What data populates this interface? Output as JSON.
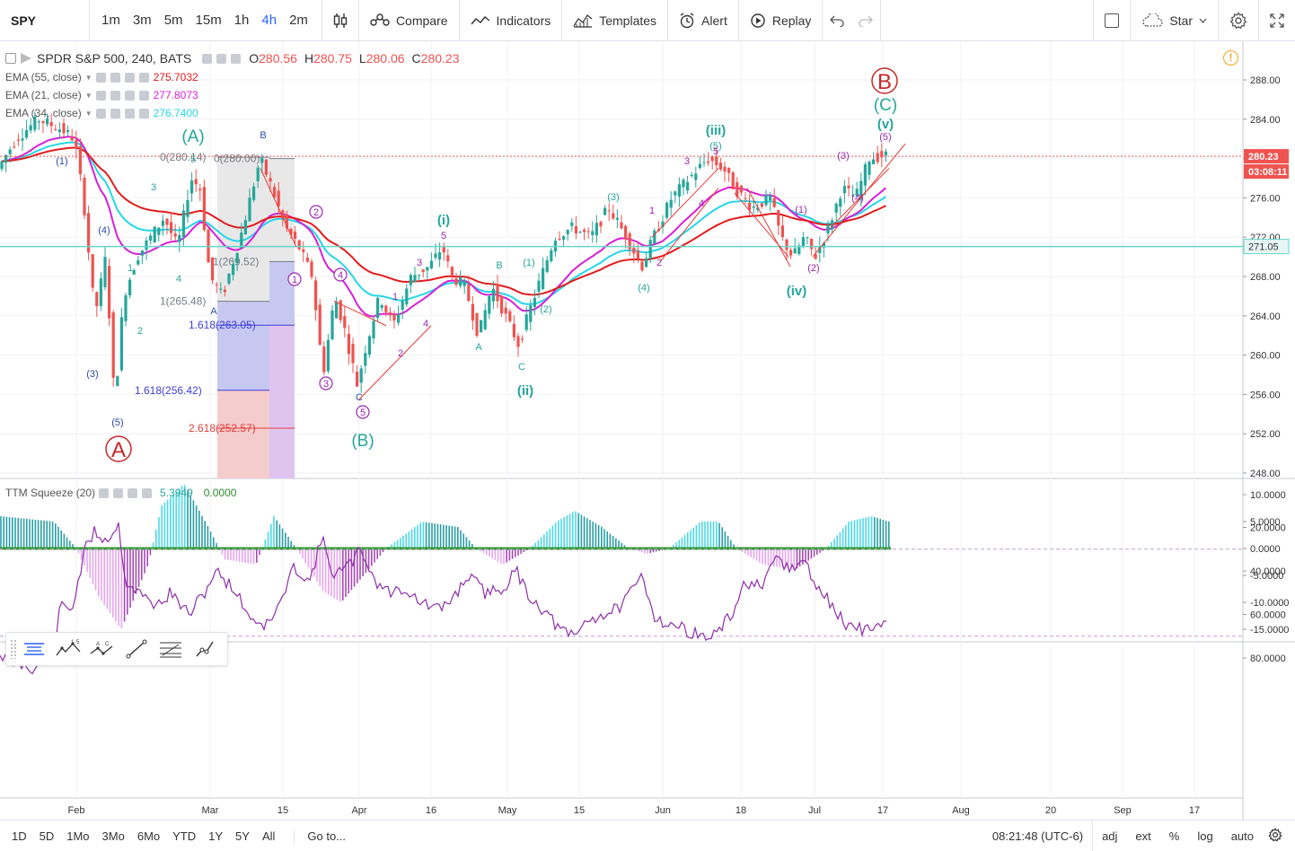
{
  "toolbar": {
    "symbol": "SPY",
    "intervals": [
      "1m",
      "3m",
      "5m",
      "15m",
      "1h",
      "4h",
      "2m"
    ],
    "active_interval": "4h",
    "compare": "Compare",
    "indicators": "Indicators",
    "templates": "Templates",
    "alert": "Alert",
    "replay": "Replay",
    "layout_name": "Star"
  },
  "legend": {
    "title": "SPDR S&P 500, 240, BATS",
    "ohlc": [
      {
        "k": "O",
        "v": "280.56"
      },
      {
        "k": "H",
        "v": "280.75"
      },
      {
        "k": "L",
        "v": "280.06"
      },
      {
        "k": "C",
        "v": "280.23"
      }
    ],
    "studies": [
      {
        "name": "EMA (55, close)",
        "value": "275.7032",
        "color": "#e31c1c"
      },
      {
        "name": "EMA (21, close)",
        "value": "277.8073",
        "color": "#d61fd6"
      },
      {
        "name": "EMA (34, close)",
        "value": "276.7400",
        "color": "#24d6e8"
      }
    ],
    "ttm": {
      "name": "TTM Squeeze (20)",
      "v1": "5.3949",
      "v2": "0.0000"
    }
  },
  "price_axis": {
    "ticks": [
      "288.00",
      "284.00",
      "280.00",
      "276.00",
      "272.00",
      "268.00",
      "264.00",
      "260.00",
      "256.00",
      "252.00",
      "248.00"
    ],
    "last_price": "280.23",
    "countdown": "03:08:11",
    "hline_price": "271.05"
  },
  "ttm_axis": {
    "ticks": [
      "10.0000",
      "5.0000",
      "0.0000",
      "-5.0000",
      "-10.0000",
      "-15.0000"
    ]
  },
  "rsi_axis": {
    "ticks": [
      "80.0000",
      "60.0000",
      "40.0000",
      "20.0000"
    ]
  },
  "time_axis": {
    "labels": [
      "Feb",
      "Mar",
      "15",
      "Apr",
      "16",
      "May",
      "15",
      "Jun",
      "18",
      "Jul",
      "17",
      "Aug",
      "20",
      "Sep",
      "17"
    ]
  },
  "fib": {
    "levels": [
      {
        "label": "0(280.14)",
        "color": "#787b86"
      },
      {
        "label": "0(280.00)",
        "color": "#787b86"
      },
      {
        "label": "1(269.52)",
        "color": "#787b86"
      },
      {
        "label": "1(265.48)",
        "color": "#787b86"
      },
      {
        "label": "1.618(263.05)",
        "color": "#3f3fd6"
      },
      {
        "label": "1.618(256.42)",
        "color": "#3f3fd6"
      },
      {
        "label": "2.618(252.57)",
        "color": "#e03c3c"
      }
    ]
  },
  "wave_labels": {
    "major": [
      "A",
      "B"
    ],
    "intermediate": [
      "(A)",
      "(B)",
      "(C)"
    ],
    "minor": [
      "(i)",
      "(ii)",
      "(iii)",
      "(iv)",
      "(v)"
    ],
    "circled": [
      "1",
      "2",
      "3",
      "4",
      "5"
    ],
    "small": [
      "(1)",
      "(2)",
      "(3)",
      "(4)",
      "(5)",
      "1",
      "2",
      "3",
      "4",
      "5",
      "A",
      "B",
      "C"
    ]
  },
  "bottom": {
    "ranges": [
      "1D",
      "5D",
      "1Mo",
      "3Mo",
      "6Mo",
      "YTD",
      "1Y",
      "5Y",
      "All"
    ],
    "goto": "Go to...",
    "clock": "08:21:48 (UTC-6)",
    "adj": "adj",
    "ext": "ext",
    "pct": "%",
    "log": "log",
    "auto": "auto"
  },
  "colors": {
    "up": "#26a69a",
    "down": "#ef5350",
    "accent": "#2962ff",
    "ema55": "#e31c1c",
    "ema21": "#d61fd6",
    "ema34": "#24d6e8",
    "hline": "#64d7c9",
    "rsi_band": "#efe0fa",
    "rsi_line": "#8e2fa8"
  }
}
